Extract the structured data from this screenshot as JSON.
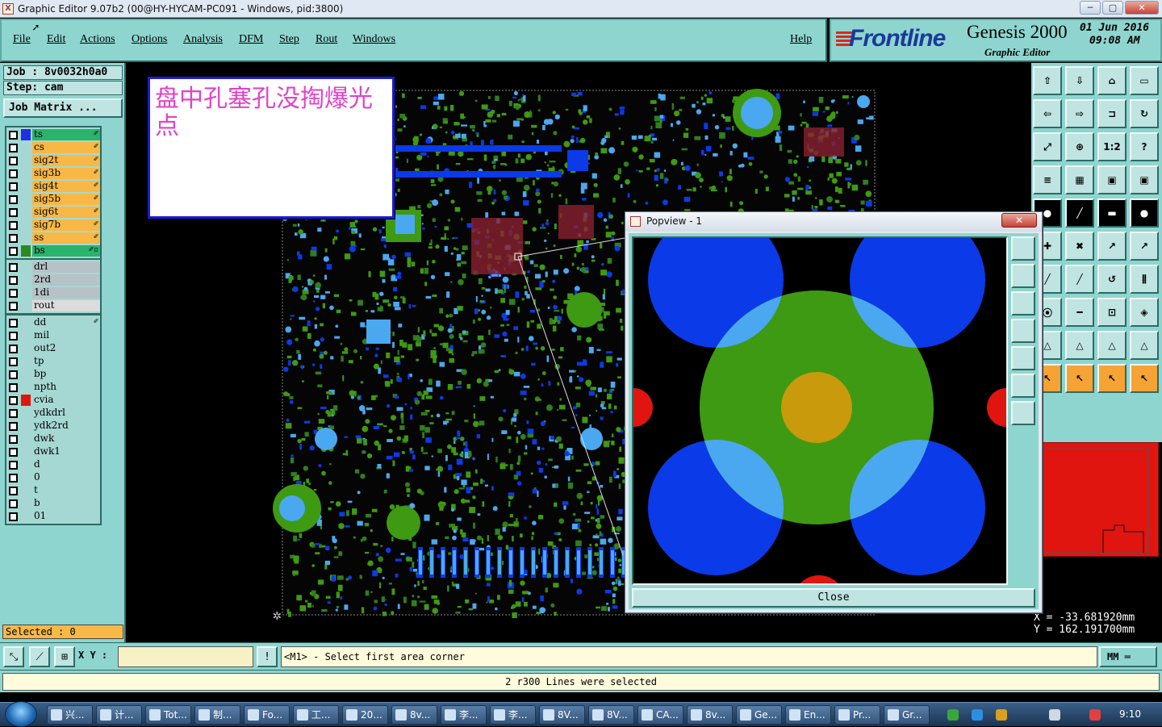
{
  "window": {
    "title": "Graphic Editor 9.07b2 (00@HY-HYCAM-PC091 - Windows, pid:3800)",
    "min": "─",
    "max": "▢",
    "close": "✕"
  },
  "menu": [
    "File",
    "Edit",
    "Actions",
    "Options",
    "Analysis",
    "DFM",
    "Step",
    "Rout",
    "Windows"
  ],
  "help": "Help",
  "brand": {
    "logo": "Frontline",
    "product": "Genesis 2000",
    "subtitle": "Graphic Editor",
    "date": "01 Jun 2016",
    "time": "09:08 AM"
  },
  "job": {
    "job_line": "Job : 8v0032h0a0",
    "step_line": "Step: cam",
    "matrix_button": "Job Matrix ..."
  },
  "layers": {
    "group1": [
      {
        "name": "ts",
        "color": "#29b36b",
        "swatch": "#1e2fe6",
        "flag": "✐"
      },
      {
        "name": "cs",
        "color": "#f7b846",
        "swatch": "",
        "flag": "✐"
      },
      {
        "name": "sig2t",
        "color": "#f7b846",
        "swatch": "",
        "flag": "✐"
      },
      {
        "name": "sig3b",
        "color": "#f7b846",
        "swatch": "",
        "flag": "✐"
      },
      {
        "name": "sig4t",
        "color": "#f7b846",
        "swatch": "",
        "flag": "✐"
      },
      {
        "name": "sig5b",
        "color": "#f7b846",
        "swatch": "",
        "flag": "✐"
      },
      {
        "name": "sig6t",
        "color": "#f7b846",
        "swatch": "",
        "flag": "✐"
      },
      {
        "name": "sig7b",
        "color": "#f7b846",
        "swatch": "",
        "flag": "✐"
      },
      {
        "name": "ss",
        "color": "#f7b846",
        "swatch": "",
        "flag": "✐"
      },
      {
        "name": "bs",
        "color": "#29b36b",
        "swatch": "#2a8a23",
        "flag": "✐▫"
      }
    ],
    "group2": [
      {
        "name": "drl",
        "color": "#b7c2c6"
      },
      {
        "name": "2rd",
        "color": "#b7c2c6"
      },
      {
        "name": "1di",
        "color": "#b7c2c6"
      },
      {
        "name": "rout",
        "color": "#dcdcdc"
      }
    ],
    "group3": [
      {
        "name": "dd",
        "color": "#a6d8d3",
        "flag": "✐"
      },
      {
        "name": "mil",
        "color": "#a6d8d3"
      },
      {
        "name": "out2",
        "color": "#a6d8d3"
      },
      {
        "name": "tp",
        "color": "#a6d8d3"
      },
      {
        "name": "bp",
        "color": "#a6d8d3"
      },
      {
        "name": "npth",
        "color": "#a6d8d3"
      },
      {
        "name": "cvia",
        "color": "#a6d8d3",
        "swatch": "#e0150f"
      },
      {
        "name": "ydkdrl",
        "color": "#a6d8d3"
      },
      {
        "name": "ydk2rd",
        "color": "#a6d8d3"
      },
      {
        "name": "dwk",
        "color": "#a6d8d3"
      },
      {
        "name": "dwk1",
        "color": "#a6d8d3"
      },
      {
        "name": "d",
        "color": "#a6d8d3"
      },
      {
        "name": "0",
        "color": "#a6d8d3"
      },
      {
        "name": "t",
        "color": "#a6d8d3"
      },
      {
        "name": "b",
        "color": "#a6d8d3"
      },
      {
        "name": "01",
        "color": "#a6d8d3"
      }
    ]
  },
  "selected": "Selected : 0",
  "annotation": "盘中孔塞孔没掏爆光点",
  "popview": {
    "title": "Popview - 1",
    "close_x": "✕",
    "close_button": "Close"
  },
  "coords": {
    "x": "X = -33.681920mm",
    "y": "Y = 162.191700mm"
  },
  "command": {
    "xy_label": "X Y :",
    "xy_value": "",
    "bang": "!",
    "prompt": "<M1> - Select first area corner",
    "units": "MM ═"
  },
  "status": "2 r300 Lines were selected",
  "taskbar": {
    "tasks": [
      "兴...",
      "计...",
      "Tot...",
      "制...",
      "Fo...",
      "工...",
      "20...",
      "8v...",
      "李...",
      "李...",
      "8V...",
      "8V...",
      "CA...",
      "8v...",
      "Ge...",
      "En...",
      "Pr...",
      "Gr..."
    ],
    "clock": "9:10"
  },
  "colors": {
    "panel": "#8fd5cf",
    "pad_blue": "#0b3ae8",
    "pad_light_blue": "#4aa8f0",
    "pad_green": "#3e9a12",
    "pad_orange": "#c89a0c",
    "pad_red": "#e0150f"
  }
}
